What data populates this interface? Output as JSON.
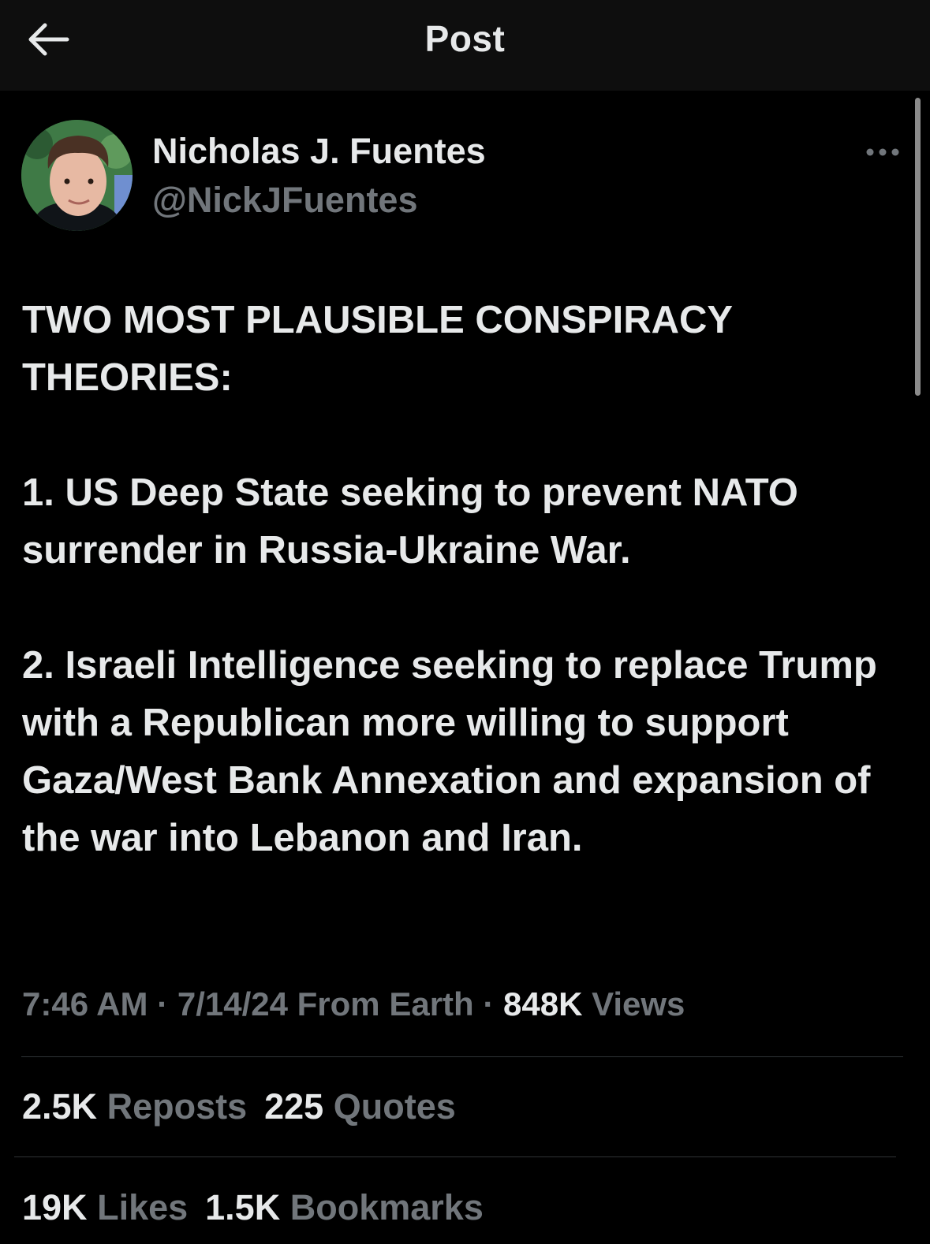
{
  "header": {
    "title": "Post",
    "back_icon": "arrow-left-icon"
  },
  "author": {
    "name": "Nicholas J. Fuentes",
    "handle": "@NickJFuentes"
  },
  "post": {
    "text": "TWO MOST PLAUSIBLE CONSPIRACY THEORIES:\n\n1. US Deep State seeking to prevent NATO surrender in Russia-Ukraine War.\n\n2. Israeli Intelligence seeking to replace Trump with a Republican more willing to support Gaza/West Bank Annexation and expansion of the war into Lebanon and Iran."
  },
  "meta": {
    "time": "7:46 AM",
    "date": "7/14/24",
    "location": "From Earth",
    "sep": "·",
    "views_count": "848K",
    "views_label": "Views"
  },
  "stats": {
    "reposts_count": "2.5K",
    "reposts_label": "Reposts",
    "quotes_count": "225",
    "quotes_label": "Quotes",
    "likes_count": "19K",
    "likes_label": "Likes",
    "bookmarks_count": "1.5K",
    "bookmarks_label": "Bookmarks"
  },
  "colors": {
    "background": "#000000",
    "header_bg": "#0e0e0e",
    "text_primary": "#e7e9ea",
    "text_secondary": "#71767b",
    "divider": "#2f3336"
  }
}
